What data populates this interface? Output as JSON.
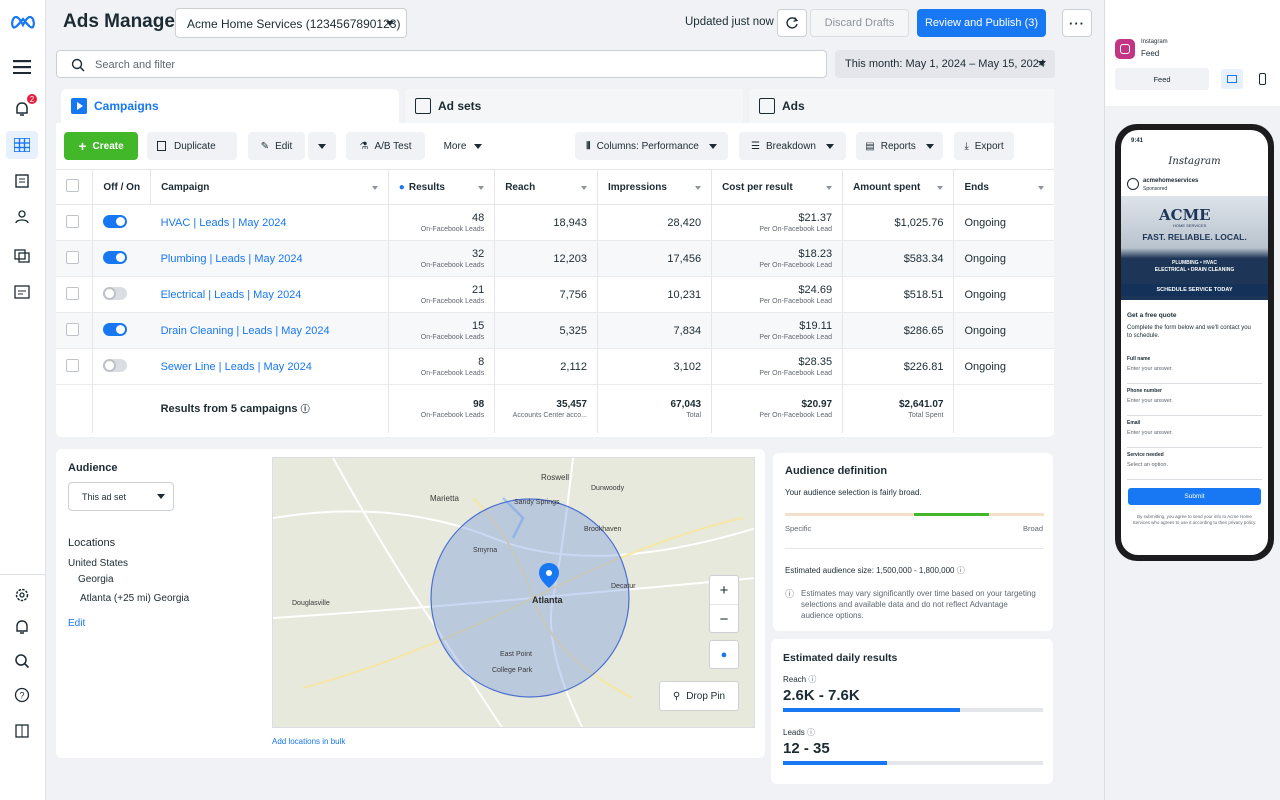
{
  "app": {
    "title": "Ads Manager"
  },
  "account": {
    "name": "Acme Home Services (1234567890123)"
  },
  "header": {
    "updated": "Updated just now",
    "discard_label": "Discard Drafts",
    "publish_label": "Review and Publish (3)"
  },
  "rail": {
    "notification_count": "2"
  },
  "search": {
    "placeholder": "Search and filter"
  },
  "daterange": {
    "label": "This month: May 1, 2024 – May 15, 2024"
  },
  "tabs": [
    {
      "label": "Campaigns"
    },
    {
      "label": "Ad sets"
    },
    {
      "label": "Ads"
    }
  ],
  "toolbar": {
    "create": "Create",
    "duplicate": "Duplicate",
    "edit": "Edit",
    "ab_test": "A/B Test",
    "more": "More",
    "columns": "Columns: Performance",
    "breakdown": "Breakdown",
    "reports": "Reports",
    "export": "Export"
  },
  "table": {
    "headers": [
      "Off / On",
      "Campaign",
      "Results",
      "Reach",
      "Impressions",
      "Cost per result",
      "Amount spent",
      "Ends"
    ],
    "rows": [
      {
        "on": true,
        "campaign": "HVAC | Leads | May 2024",
        "results": "48",
        "results_sub": "On-Facebook Leads",
        "reach": "18,943",
        "impressions": "28,420",
        "cpr": "$21.37",
        "cpr_sub": "Per On-Facebook Lead",
        "spent": "$1,025.76",
        "ends": "Ongoing"
      },
      {
        "on": true,
        "campaign": "Plumbing | Leads | May 2024",
        "results": "32",
        "results_sub": "On-Facebook Leads",
        "reach": "12,203",
        "impressions": "17,456",
        "cpr": "$18.23",
        "cpr_sub": "Per On-Facebook Lead",
        "spent": "$583.34",
        "ends": "Ongoing"
      },
      {
        "on": false,
        "campaign": "Electrical | Leads | May 2024",
        "results": "21",
        "results_sub": "On-Facebook Leads",
        "reach": "7,756",
        "impressions": "10,231",
        "cpr": "$24.69",
        "cpr_sub": "Per On-Facebook Lead",
        "spent": "$518.51",
        "ends": "Ongoing"
      },
      {
        "on": true,
        "campaign": "Drain Cleaning | Leads | May 2024",
        "results": "15",
        "results_sub": "On-Facebook Leads",
        "reach": "5,325",
        "impressions": "7,834",
        "cpr": "$19.11",
        "cpr_sub": "Per On-Facebook Lead",
        "spent": "$286.65",
        "ends": "Ongoing"
      },
      {
        "on": false,
        "campaign": "Sewer Line | Leads | May 2024",
        "results": "8",
        "results_sub": "On-Facebook Leads",
        "reach": "2,112",
        "impressions": "3,102",
        "cpr": "$28.35",
        "cpr_sub": "Per On-Facebook Lead",
        "spent": "$226.81",
        "ends": "Ongoing"
      }
    ],
    "totals": {
      "label": "Results from 5 campaigns",
      "results": "98",
      "results_sub": "On-Facebook Leads",
      "reach": "35,457",
      "reach_sub": "Accounts Center acco...",
      "impressions": "67,043",
      "impressions_sub": "Total",
      "cpr": "$20.97",
      "cpr_sub": "Per On-Facebook Lead",
      "spent": "$2,641.07",
      "spent_sub": "Total Spent"
    }
  },
  "audience": {
    "title": "Audience",
    "select": "This ad set",
    "locations_title": "Locations",
    "country": "United States",
    "state": "Georgia",
    "city": "Atlanta (+25 mi) Georgia",
    "edit": "Edit",
    "add_bulk": "Add locations in bulk",
    "drop_pin": "Drop Pin",
    "map_labels": {
      "roswell": "Roswell",
      "marietta": "Marietta",
      "dunwoody": "Dunwoody",
      "sandy_springs": "Sandy Springs",
      "brookhaven": "Brookhaven",
      "smyrna": "Smyrna",
      "decatur": "Decatur",
      "douglasville": "Douglasville",
      "atlanta": "Atlanta",
      "east_point": "East Point",
      "college_park": "College Park"
    }
  },
  "definition": {
    "title": "Audience definition",
    "desc": "Your audience selection is fairly broad.",
    "specific": "Specific",
    "broad": "Broad",
    "size_label": "Estimated audience size:",
    "size_value": "1,500,000 - 1,800,000",
    "note": "Estimates may vary significantly over time based on your targeting selections and available data and do not reflect Advantage audience options."
  },
  "estimates": {
    "title": "Estimated daily results",
    "reach_label": "Reach",
    "reach_value": "2.6K - 7.6K",
    "reach_fill": 0.68,
    "leads_label": "Leads",
    "leads_value": "12 - 35",
    "leads_fill": 0.4
  },
  "preview": {
    "platform": "Instagram",
    "placement": "Feed",
    "select": "Feed",
    "phone": {
      "time": "9:41",
      "app": "Instagram",
      "account": "acmehomeservices",
      "sponsored": "Sponsored",
      "brand": "ACME",
      "brand_sub": "HOME SERVICES",
      "tagline": "FAST. RELIABLE. LOCAL.",
      "services": "PLUMBING • HVAC\nELECTRICAL • DRAIN CLEANING",
      "cta_banner": "SCHEDULE SERVICE TODAY",
      "form_title": "Get a free quote",
      "form_desc": "Complete the form below and we'll contact you to schedule.",
      "fields": [
        {
          "label": "Full name",
          "placeholder": "Enter your answer."
        },
        {
          "label": "Phone number",
          "placeholder": "Enter your answer."
        },
        {
          "label": "Email",
          "placeholder": "Enter your answer."
        },
        {
          "label": "Service needed",
          "placeholder": "Select an option."
        }
      ],
      "submit": "Submit",
      "disclaimer": "By submitting, you agree to send your info to Acme Home Services who agrees to use it according to their privacy policy."
    }
  },
  "colors": {
    "primary": "#1877f2",
    "create": "#42b72a",
    "badge": "#e41e3f",
    "instagram": "#c13584"
  }
}
